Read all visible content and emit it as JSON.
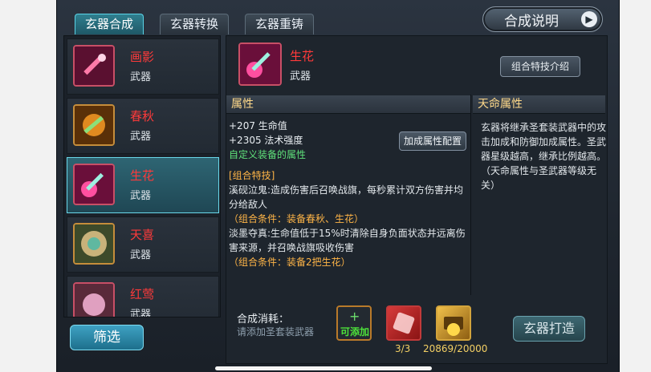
{
  "tabs": [
    {
      "label": "玄器合成",
      "active": true
    },
    {
      "label": "玄器转换",
      "active": false
    },
    {
      "label": "玄器重铸",
      "active": false
    }
  ],
  "help_button": {
    "label": "合成说明"
  },
  "weapon_list": [
    {
      "name": "画影",
      "type": "武器"
    },
    {
      "name": "春秋",
      "type": "武器"
    },
    {
      "name": "生花",
      "type": "武器",
      "selected": true
    },
    {
      "name": "天喜",
      "type": "武器"
    },
    {
      "name": "红莺",
      "type": "武器"
    }
  ],
  "filter_button": {
    "label": "筛选"
  },
  "selected": {
    "name": "生花",
    "type": "武器"
  },
  "combo_intro_button": {
    "label": "组合特技介绍"
  },
  "attributes": {
    "title": "属性",
    "lines": [
      "+207 生命值",
      "+2305 法术强度"
    ],
    "custom": "自定义装备的属性",
    "config_button": "加成属性配置"
  },
  "combo_skill": {
    "heading": "[组合特技]",
    "skill1": "溪砚泣鬼:造成伤害后召唤战旗，每秒累计双方伤害并均分给敌人",
    "skill1_cond": "（组合条件：装备春秋、生花）",
    "skill2": "淡墨夺真:生命值低于15%时清除自身负面状态并远离伤害来源，并召唤战旗吸收伤害",
    "skill2_cond": "（组合条件：装备2把生花）"
  },
  "fate": {
    "title": "天命属性",
    "text": "玄器将继承圣套装武器中的攻击加成和防御加成属性。圣武器星级越高，继承比例越高。",
    "note": "（天命属性与圣武器等级无关）"
  },
  "cost": {
    "label": "合成消耗：",
    "hint": "请添加圣套装武器",
    "add_slot_label": "可添加",
    "count1": "3/3",
    "count2": "20869/20000"
  },
  "forge_button": {
    "label": "玄器打造"
  },
  "colors": {
    "accent": "#5bd3e6",
    "item_name": "#ff3a3a",
    "section_title": "#ffd98a",
    "green": "#5fe07a",
    "orange": "#ffb547"
  }
}
